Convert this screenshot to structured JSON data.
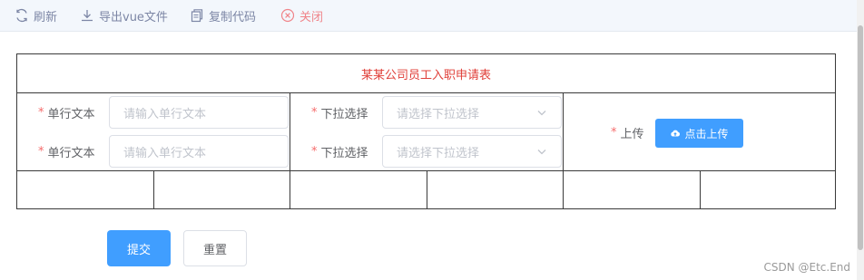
{
  "toolbar": {
    "refresh": "刷新",
    "export": "导出vue文件",
    "copy": "复制代码",
    "close": "关闭"
  },
  "form": {
    "title": "某某公司员工入职申请表",
    "required_mark": "*",
    "row1": {
      "text_label": "单行文本",
      "text_placeholder": "请输入单行文本",
      "select_label": "下拉选择",
      "select_placeholder": "请选择下拉选择"
    },
    "row2": {
      "text_label": "单行文本",
      "text_placeholder": "请输入单行文本",
      "select_label": "下拉选择",
      "select_placeholder": "请选择下拉选择"
    },
    "upload": {
      "label": "上传",
      "button": "点击上传"
    }
  },
  "actions": {
    "submit": "提交",
    "reset": "重置"
  },
  "watermark": "CSDN @Etc.End",
  "colors": {
    "primary": "#409eff",
    "title_red": "#e0403a",
    "required": "#f56c6c",
    "close": "#f08489",
    "toolbar_bg": "#f3f7fc"
  }
}
